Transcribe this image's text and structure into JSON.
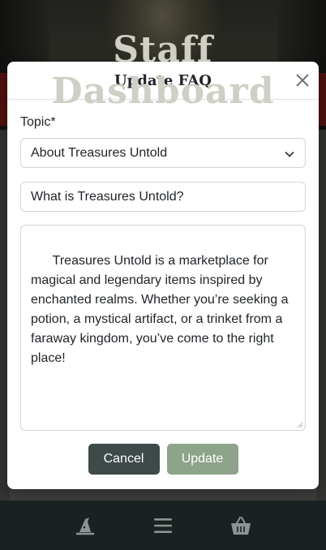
{
  "background": {
    "page_title": "Staff Dashboard"
  },
  "modal": {
    "title": "Update FAQ",
    "topic_label": "Topic*",
    "topic_selected": "About Treasures Untold",
    "question_value": "What is Treasures Untold?",
    "answer_value": "Treasures Untold is a marketplace for magical and legendary items inspired by enchanted realms. Whether you’re seeking a potion, a mystical artifact, or a trinket from a faraway kingdom, you’ve come to the right place!",
    "cancel_label": "Cancel",
    "update_label": "Update"
  },
  "bottom_nav": {
    "items": [
      {
        "icon": "wizard-hat-icon"
      },
      {
        "icon": "menu-icon"
      },
      {
        "icon": "basket-icon"
      }
    ]
  },
  "colors": {
    "cancel_button": "#3e4a4a",
    "update_button": "#8da38a",
    "nav_background": "#1b2021"
  }
}
